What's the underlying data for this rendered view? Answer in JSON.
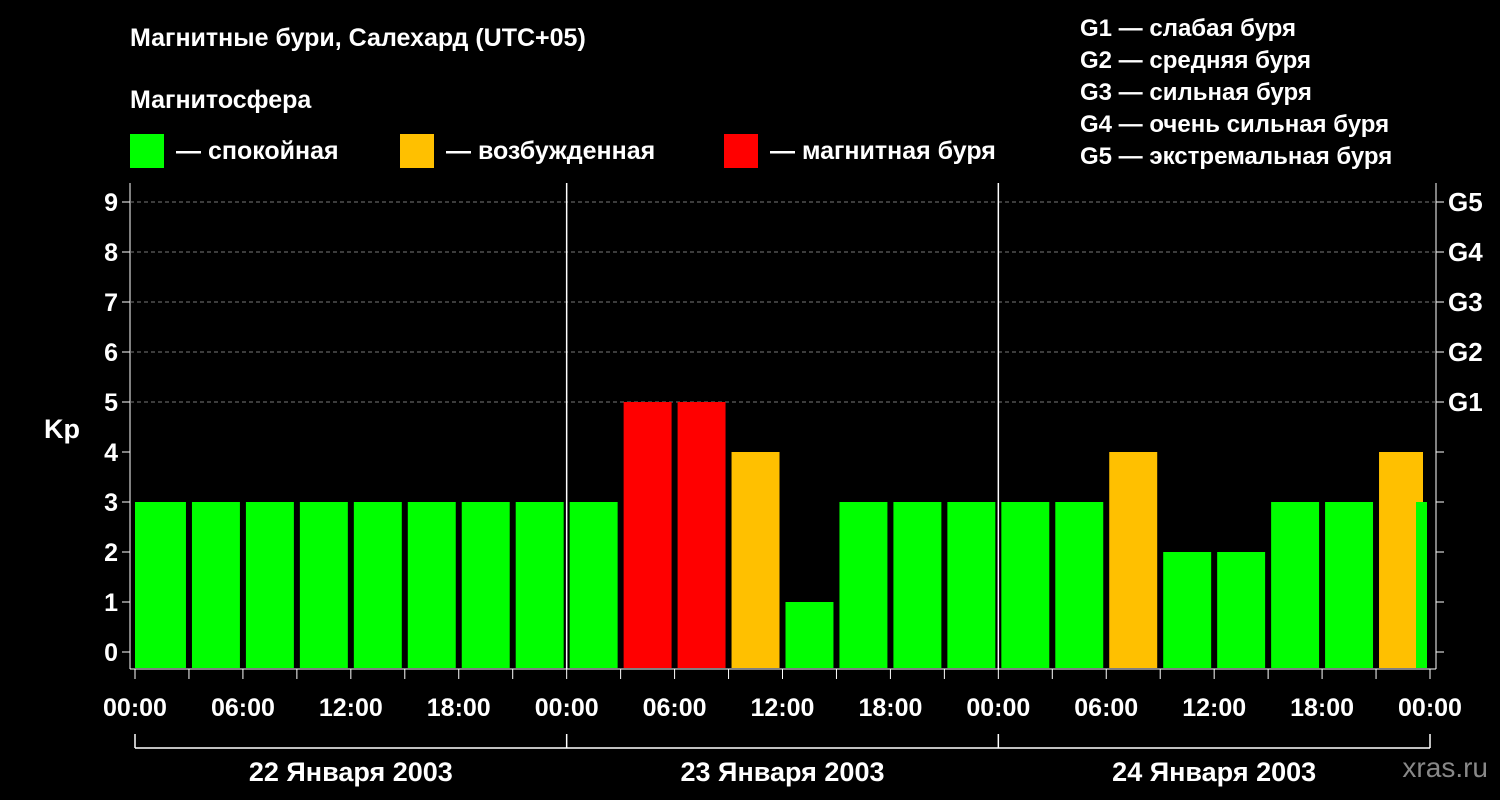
{
  "title": "Магнитные бури, Салехард (UTC+05)",
  "magnetosphere_label": "Магнитосфера",
  "legend": [
    {
      "label": "— спокойная",
      "color": "#00ff00"
    },
    {
      "label": "— возбужденная",
      "color": "#ffc000"
    },
    {
      "label": "— магнитная буря",
      "color": "#ff0000"
    }
  ],
  "g_legend": [
    "G1 — слабая буря",
    "G2 — средняя буря",
    "G3 — сильная буря",
    "G4 — очень сильная буря",
    "G5 — экстремальная буря"
  ],
  "watermark": "xras.ru",
  "chart_data": {
    "type": "bar",
    "ylabel": "Kp",
    "ylim": [
      0,
      9
    ],
    "y_ticks": [
      0,
      1,
      2,
      3,
      4,
      5,
      6,
      7,
      8,
      9
    ],
    "g_levels": [
      {
        "label": "G1",
        "kp": 5
      },
      {
        "label": "G2",
        "kp": 6
      },
      {
        "label": "G3",
        "kp": 7
      },
      {
        "label": "G4",
        "kp": 8
      },
      {
        "label": "G5",
        "kp": 9
      }
    ],
    "x_tick_labels": [
      "00:00",
      "06:00",
      "12:00",
      "18:00",
      "00:00",
      "06:00",
      "12:00",
      "18:00",
      "00:00",
      "06:00",
      "12:00",
      "18:00",
      "00:00"
    ],
    "days": [
      "22 Января 2003",
      "23 Января 2003",
      "24 Января 2003"
    ],
    "values": [
      3,
      3,
      3,
      3,
      3,
      3,
      3,
      3,
      3,
      5,
      5,
      4,
      1,
      3,
      3,
      3,
      3,
      3,
      4,
      2,
      2,
      3,
      3,
      4,
      3
    ],
    "colors": {
      "quiet": "#00ff00",
      "active": "#ffc000",
      "storm": "#ff0000"
    },
    "grid": true
  }
}
